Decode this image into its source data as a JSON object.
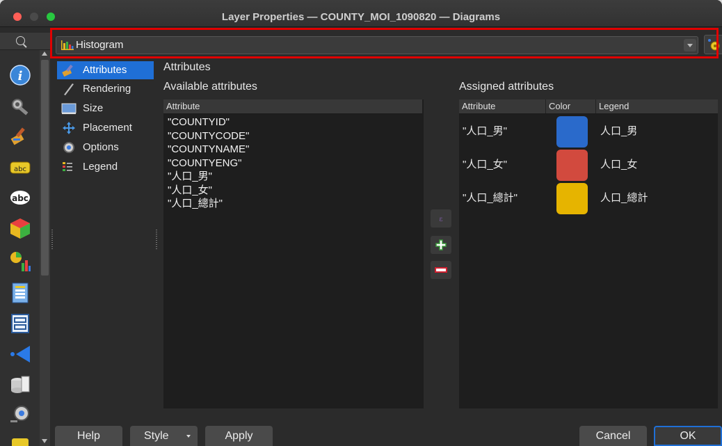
{
  "window": {
    "title": "Layer Properties — COUNTY_MOI_1090820 — Diagrams"
  },
  "diagram_type": {
    "selected": "Histogram"
  },
  "nav": {
    "items": [
      {
        "label": "Attributes",
        "icon": "paintbrush-icon",
        "selected": true
      },
      {
        "label": "Rendering",
        "icon": "pen-icon"
      },
      {
        "label": "Size",
        "icon": "size-icon"
      },
      {
        "label": "Placement",
        "icon": "move-arrows-icon"
      },
      {
        "label": "Options",
        "icon": "gear-icon"
      },
      {
        "label": "Legend",
        "icon": "legend-icon"
      }
    ]
  },
  "attributes": {
    "section_title": "Attributes",
    "available_title": "Available attributes",
    "assigned_title": "Assigned attributes",
    "available_header": "Attribute",
    "available": [
      "\"COUNTYID\"",
      "\"COUNTYCODE\"",
      "\"COUNTYNAME\"",
      "\"COUNTYENG\"",
      "\"人口_男\"",
      "\"人口_女\"",
      "\"人口_總計\""
    ],
    "assigned_headers": [
      "Attribute",
      "Color",
      "Legend"
    ],
    "assigned": [
      {
        "attribute": "\"人口_男\"",
        "color": "#2a6acb",
        "legend": "人口_男"
      },
      {
        "attribute": "\"人口_女\"",
        "color": "#d24a3e",
        "legend": "人口_女"
      },
      {
        "attribute": "\"人口_總計\"",
        "color": "#e6b400",
        "legend": "人口_總計"
      }
    ]
  },
  "buttons": {
    "help": "Help",
    "style": "Style",
    "apply": "Apply",
    "cancel": "Cancel",
    "ok": "OK"
  }
}
